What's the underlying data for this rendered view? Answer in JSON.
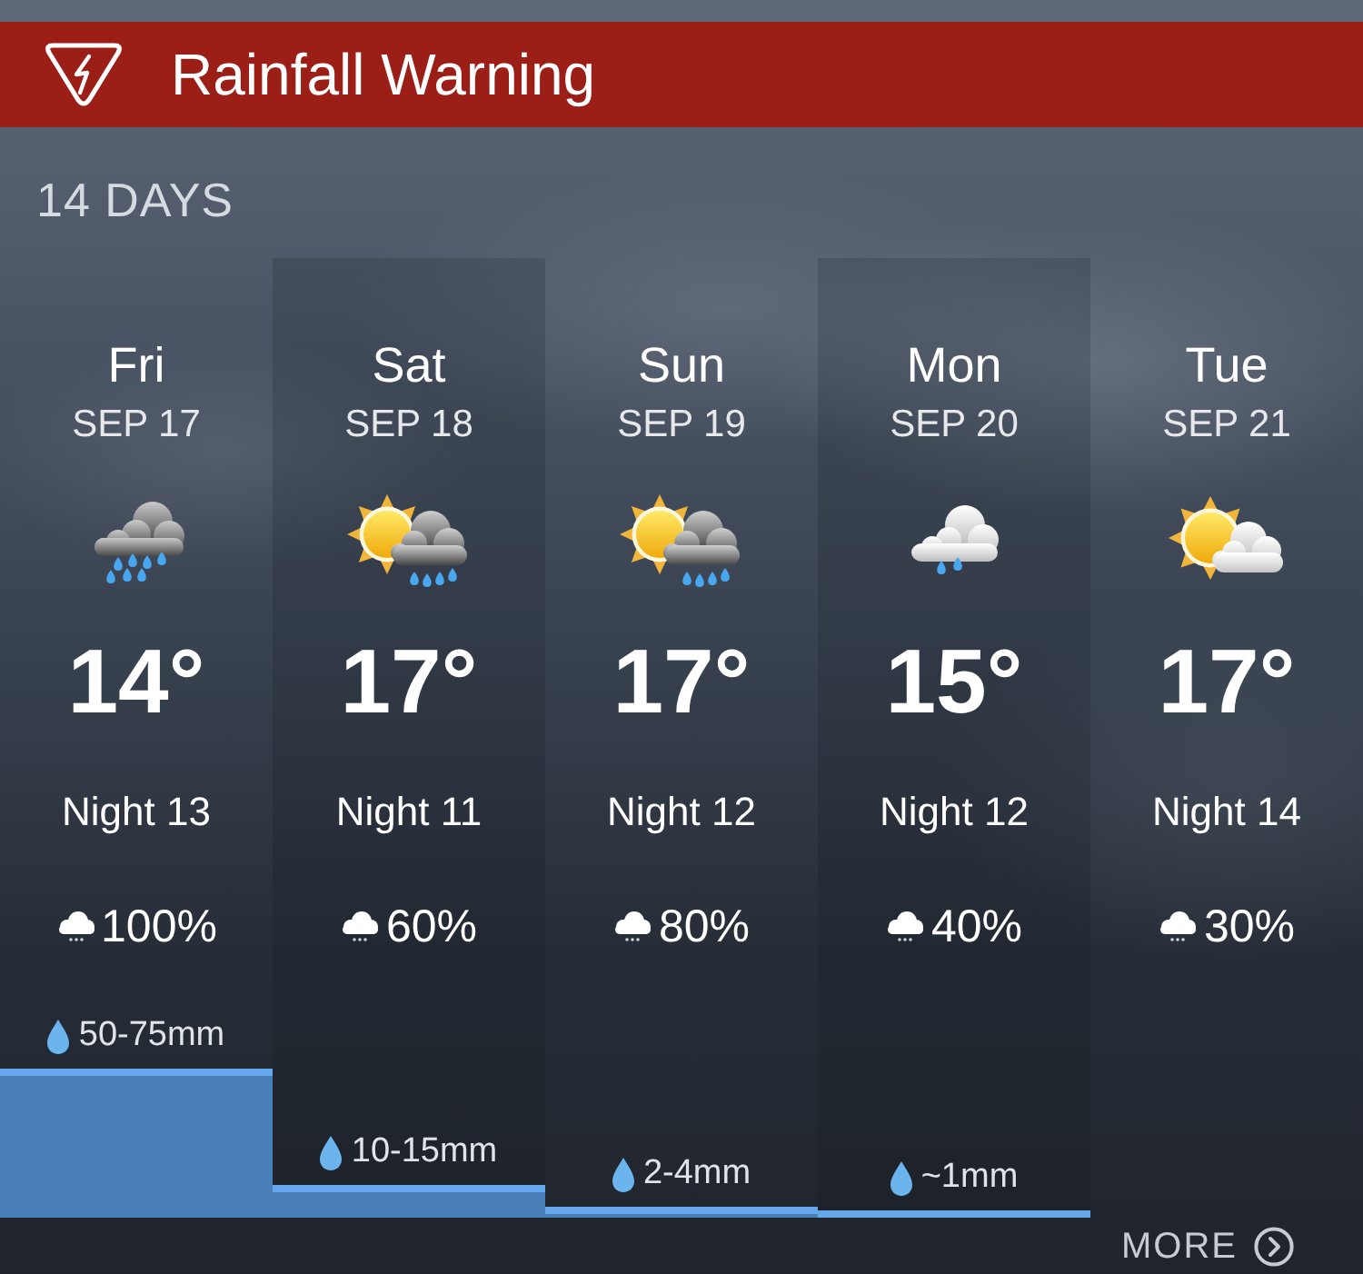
{
  "banner": {
    "title": "Rainfall Warning"
  },
  "section": {
    "title": "14 DAYS"
  },
  "days": [
    {
      "day": "Fri",
      "date": "SEP 17",
      "kind": "rain",
      "temp": "14°",
      "night": "Night 13",
      "chance": "100%",
      "rainfall": "50-75mm"
    },
    {
      "day": "Sat",
      "date": "SEP 18",
      "kind": "sun-rain",
      "temp": "17°",
      "night": "Night 11",
      "chance": "60%",
      "rainfall": "10-15mm"
    },
    {
      "day": "Sun",
      "date": "SEP 19",
      "kind": "sun-rain",
      "temp": "17°",
      "night": "Night 12",
      "chance": "80%",
      "rainfall": "2-4mm"
    },
    {
      "day": "Mon",
      "date": "SEP 20",
      "kind": "drizzle",
      "temp": "15°",
      "night": "Night 12",
      "chance": "40%",
      "rainfall": "~1mm"
    },
    {
      "day": "Tue",
      "date": "SEP 21",
      "kind": "sun-cloud",
      "temp": "17°",
      "night": "Night 14",
      "chance": "30%"
    }
  ],
  "more": {
    "label": "MORE"
  }
}
